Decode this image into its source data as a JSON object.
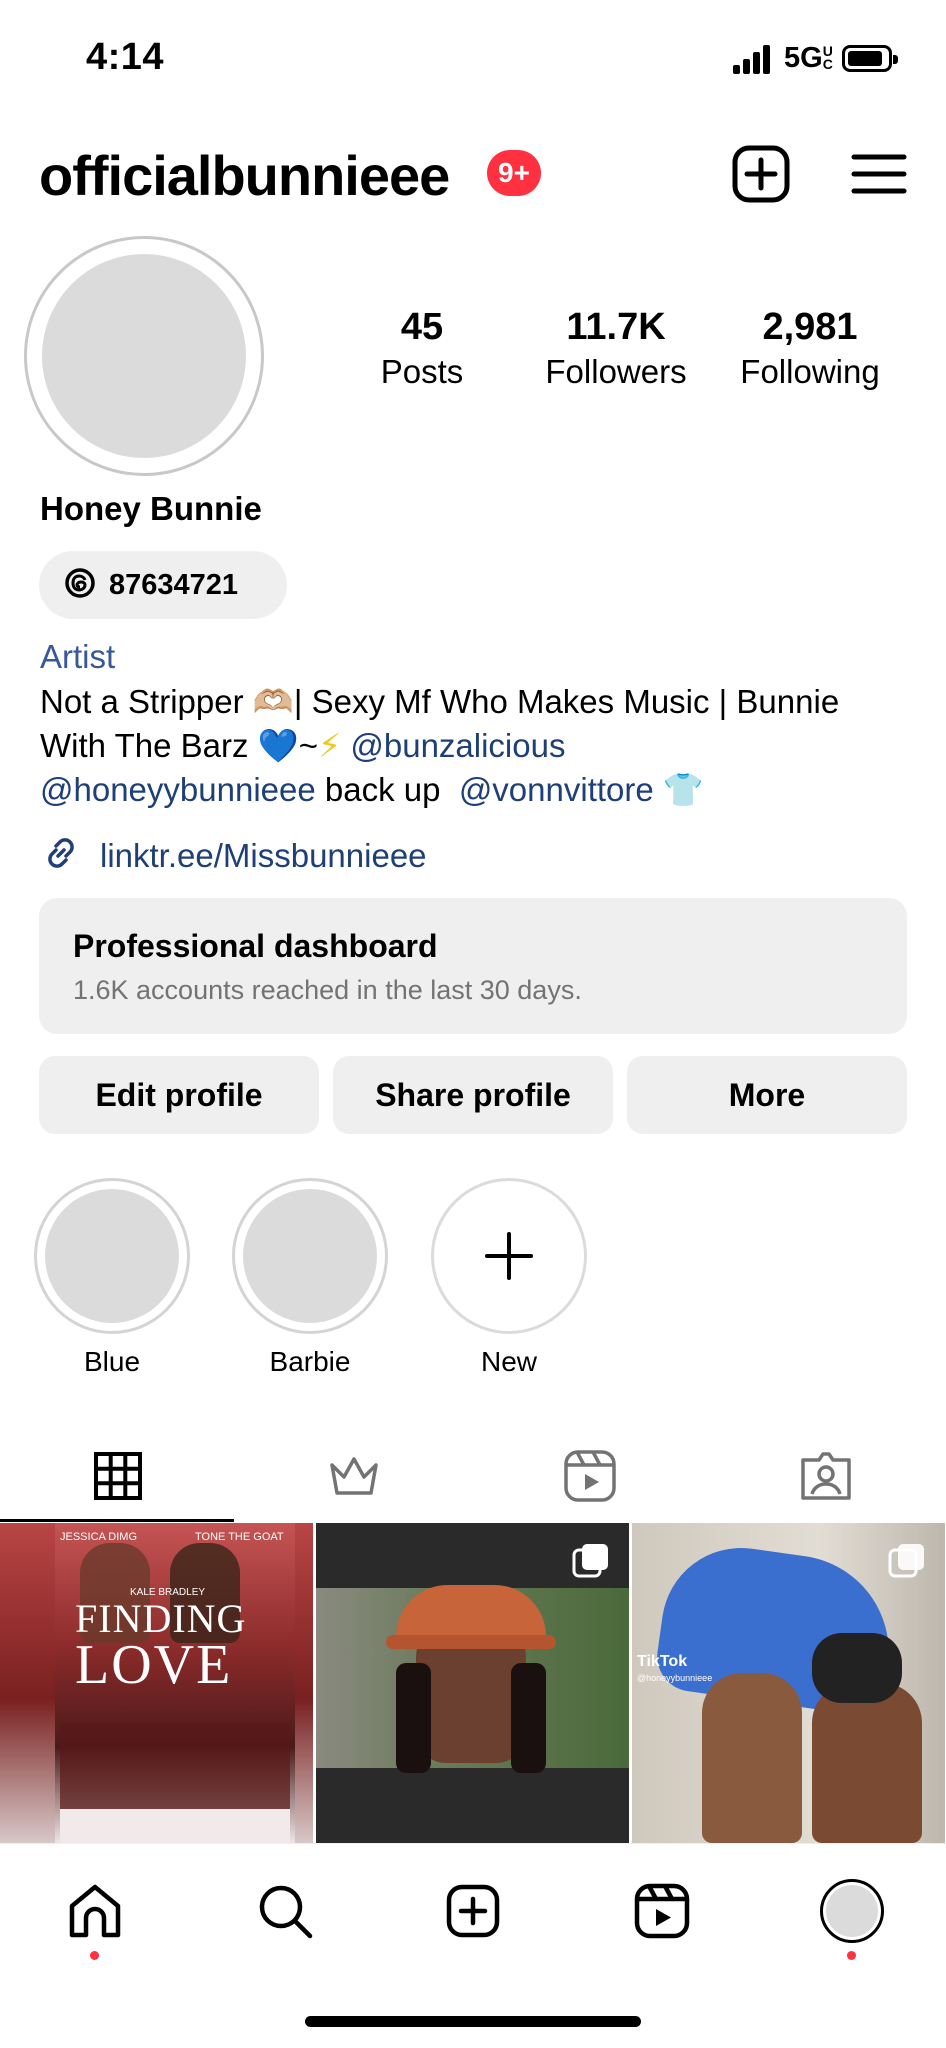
{
  "status_bar": {
    "time": "4:14",
    "network": "5G",
    "network_sub": "UC"
  },
  "header": {
    "username": "officialbunnieee",
    "notification_count": "9+",
    "create_icon": "plus-square-icon",
    "menu_icon": "hamburger-menu-icon"
  },
  "profile": {
    "stats": [
      {
        "value": "45",
        "label": "Posts"
      },
      {
        "value": "11.7K",
        "label": "Followers"
      },
      {
        "value": "2,981",
        "label": "Following"
      }
    ],
    "full_name": "Honey Bunnie",
    "threads_id": "87634721",
    "category": "Artist",
    "bio": {
      "line1_text": "Not a Stripper 🫶🏼| Sexy Mf Who Makes Music | Bunnie",
      "line2_text": "With The Barz ",
      "line2_heart": "💙",
      "line2_tilde": "~",
      "line2_bolt": "⚡",
      "line2_mention": "@bunzalicious",
      "line3_mention1": "@honeyybunnieee",
      "line3_text": " back up  ",
      "line3_mention2": "@vonnvittore",
      "line3_shirt": "👕"
    },
    "link": "linktr.ee/Missbunnieee"
  },
  "dashboard": {
    "title": "Professional dashboard",
    "subtitle": "1.6K accounts reached in the last 30 days."
  },
  "buttons": {
    "edit": "Edit profile",
    "share": "Share profile",
    "more": "More"
  },
  "highlights": [
    {
      "label": "Blue"
    },
    {
      "label": "Barbie"
    },
    {
      "label": "New"
    }
  ],
  "tabs": [
    "grid-icon",
    "crown-icon",
    "reels-icon",
    "tagged-icon"
  ],
  "posts": [
    {
      "top_left": "JESSICA DIMG",
      "top_right": "TONE THE GOAT",
      "presents": "KALE BRADLEY",
      "title1": "FINDING",
      "title2": "LOVE",
      "colors": {
        "bg": "#a43a3a",
        "band": "#c66",
        "poster": "#f0e6e6"
      }
    },
    {
      "colors": {
        "frame": "#2a2a2a",
        "hat": "#c8643a",
        "skin": "#6b4030",
        "background": "#5b7a4a"
      }
    },
    {
      "watermark_brand": "TikTok",
      "watermark_handle": "@honeyybunnieee",
      "colors": {
        "bg": "#d9d4cc",
        "suit": "#3b6fcf",
        "skin": "#8a5a3e"
      }
    }
  ],
  "bottom_nav": [
    "home-icon",
    "search-icon",
    "create-icon",
    "reels-icon",
    "profile-avatar"
  ],
  "colors": {
    "link_blue": "#1e3f78",
    "badge_red": "#ff3040",
    "pill_gray": "#efefef"
  }
}
